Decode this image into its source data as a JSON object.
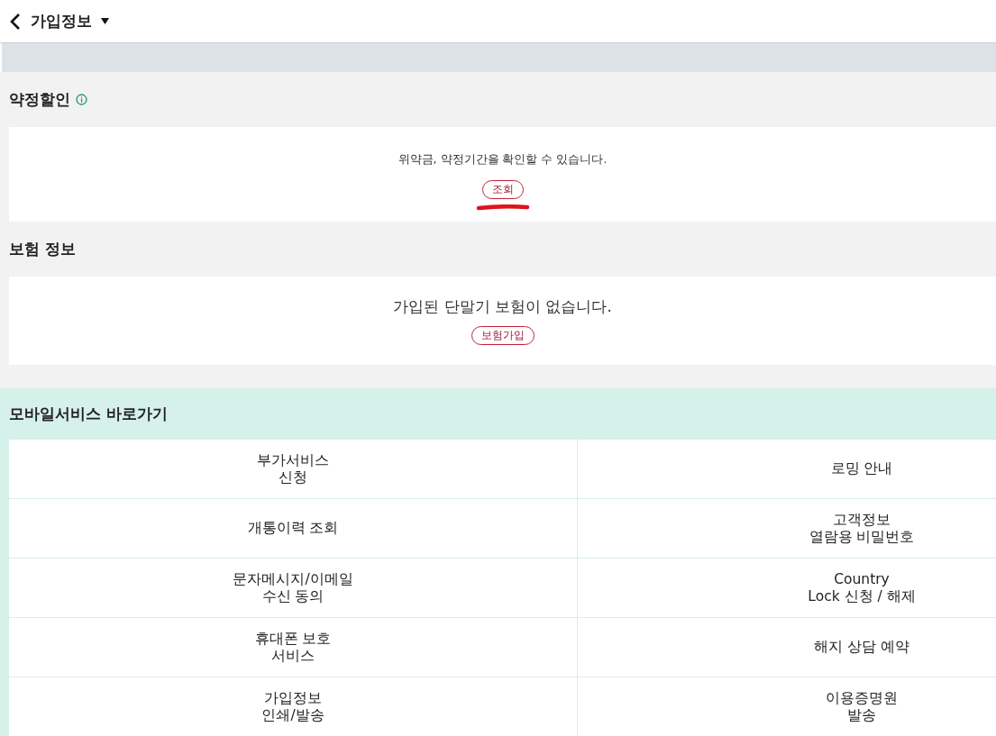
{
  "header": {
    "title": "가입정보"
  },
  "sections": [
    {
      "title": "약정할인",
      "info": true,
      "message": "위약금, 약정기간을 확인할 수 있습니다.",
      "kind": "small",
      "button": "조회",
      "marked": true
    },
    {
      "title": "보험 정보",
      "info": false,
      "message": "가입된 단말기 보험이 없습니다.",
      "kind": "large",
      "button": "보험가입",
      "marked": false
    }
  ],
  "shortcuts": {
    "title": "모바일서비스 바로가기",
    "items": [
      [
        "부가서비스\n신청",
        "로밍 안내"
      ],
      [
        "개통이력 조회",
        "고객정보\n열람용 비밀번호"
      ],
      [
        "문자메시지/이메일\n수신 동의",
        "Country\nLock 신청 / 해제"
      ],
      [
        "휴대폰 보호\n서비스",
        "해지 상담 예약"
      ],
      [
        "가입정보\n인쇄/발송",
        "이용증명원\n발송"
      ]
    ]
  }
}
